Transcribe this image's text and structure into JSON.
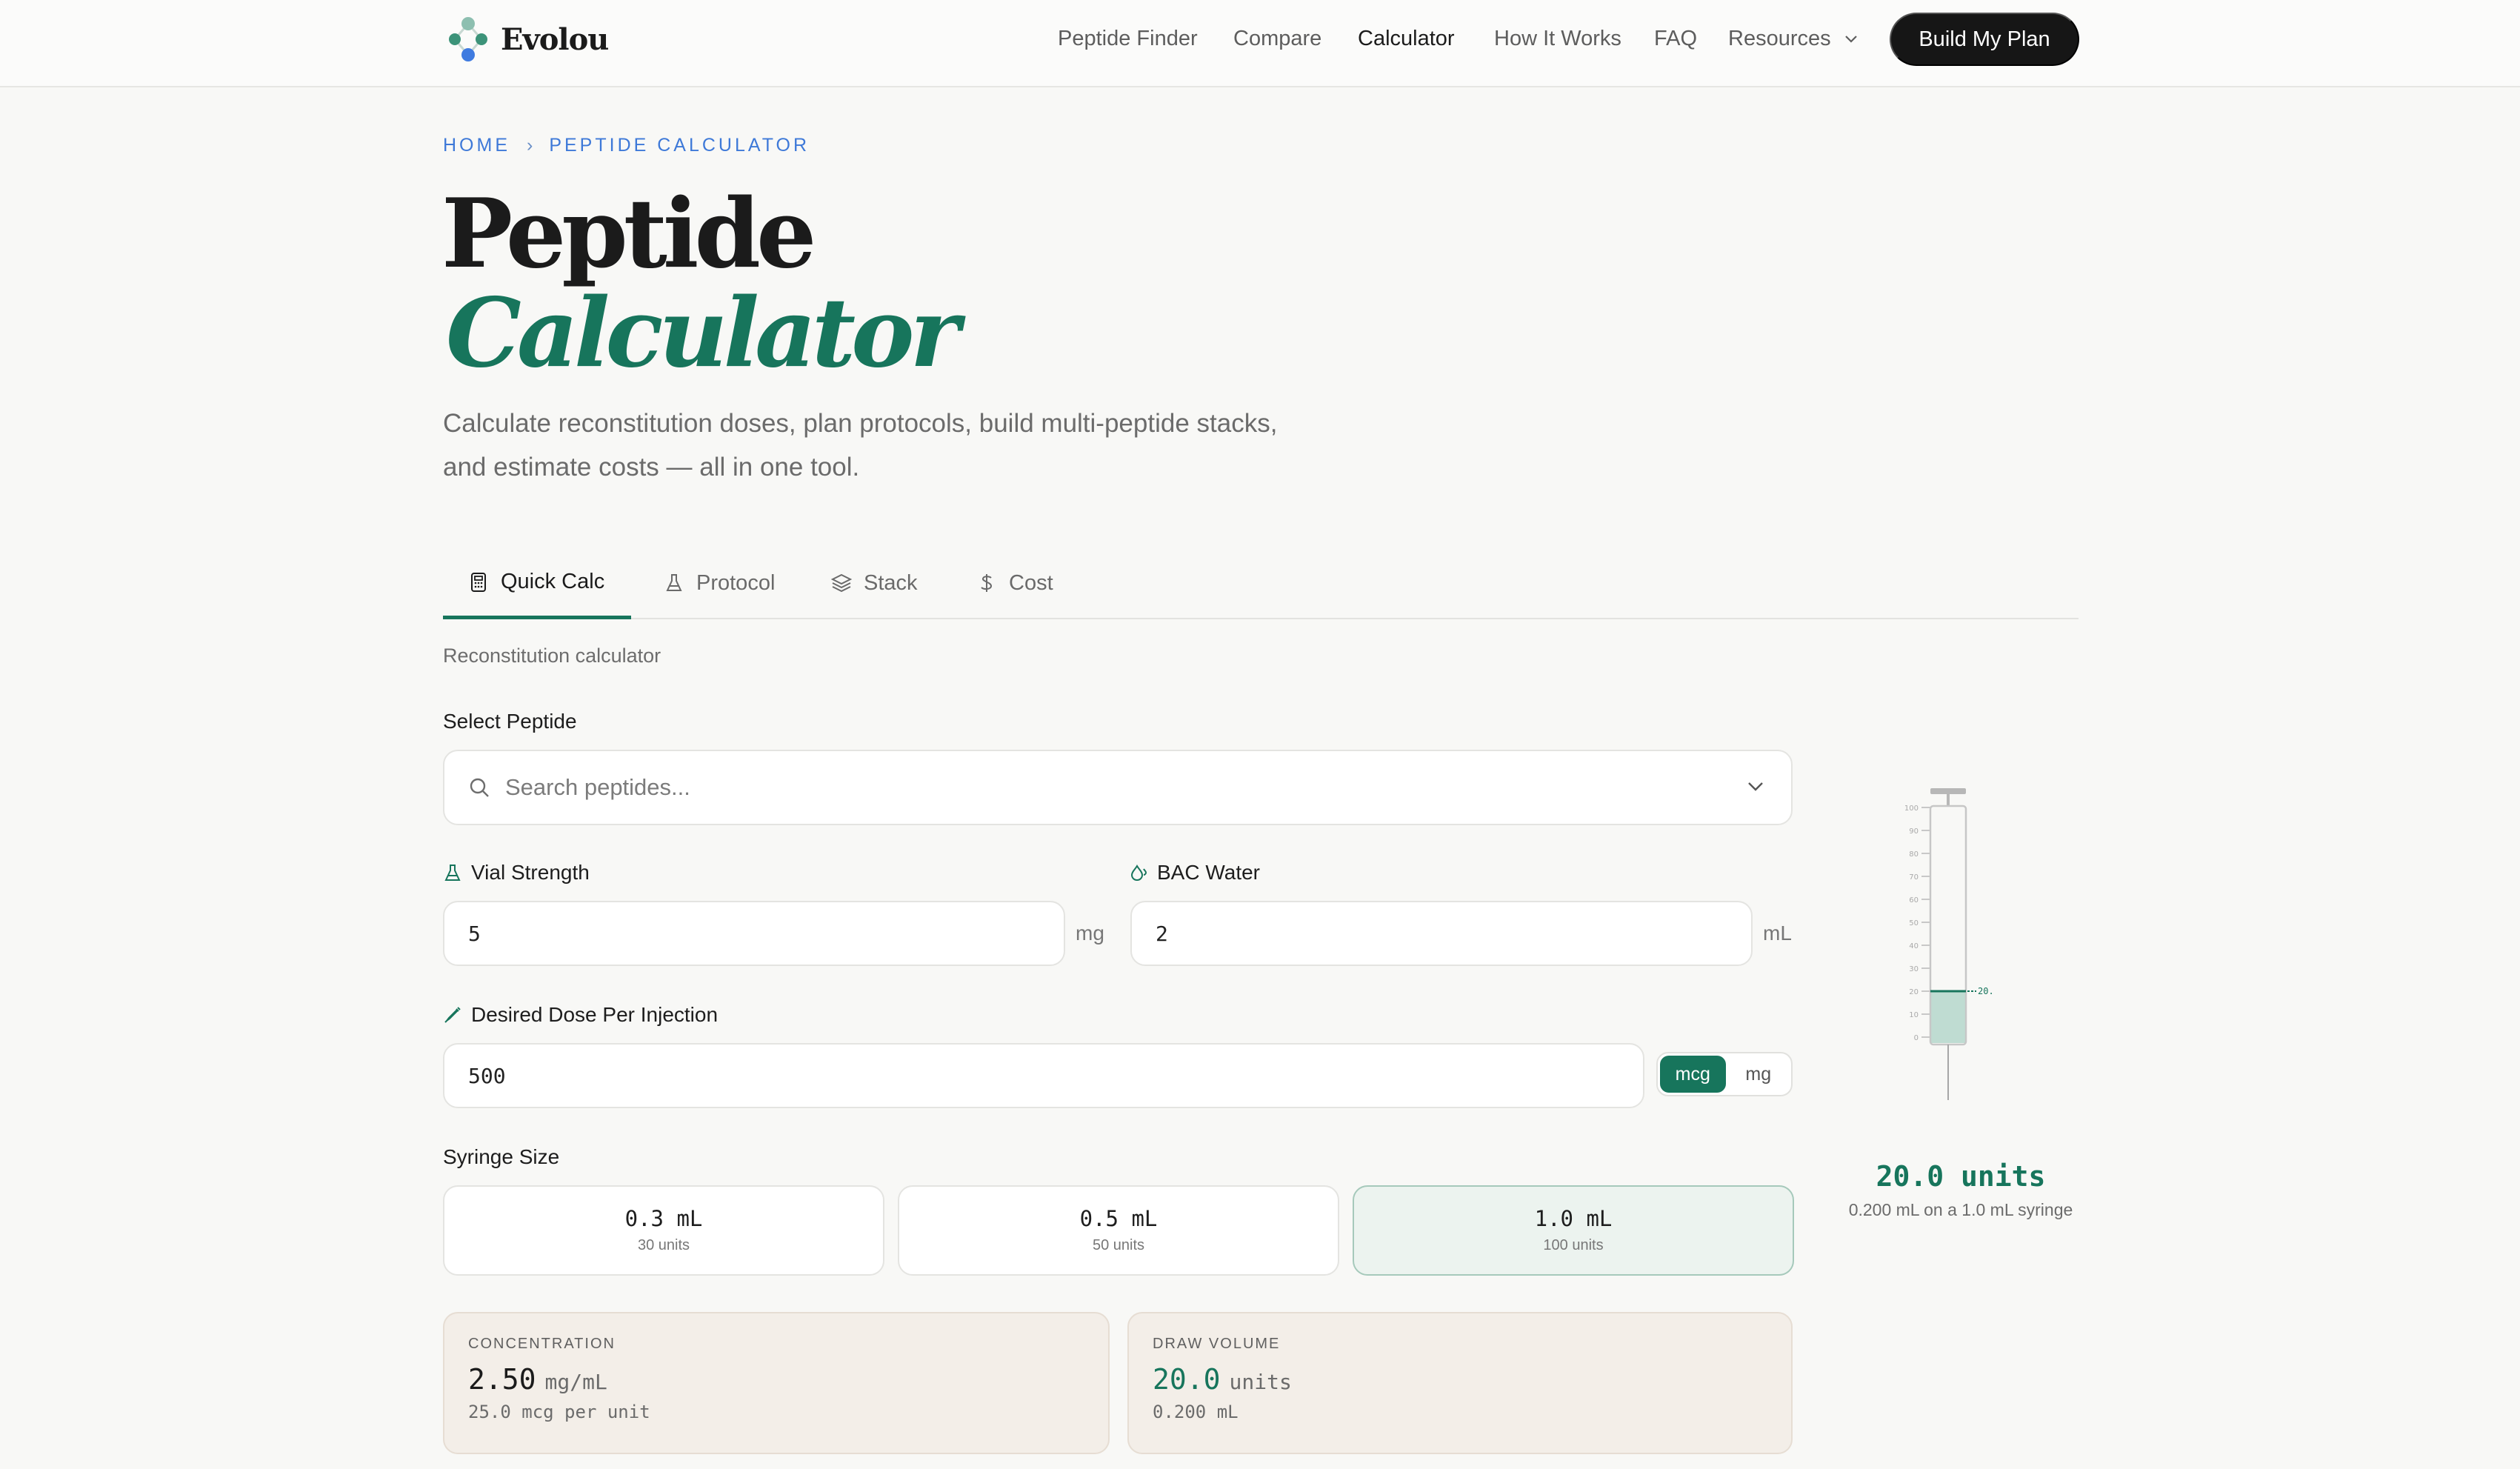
{
  "brand": {
    "name": "Evolou"
  },
  "nav": {
    "items": [
      "Peptide Finder",
      "Compare",
      "Calculator",
      "How It Works",
      "FAQ",
      "Resources"
    ],
    "active": "Calculator",
    "cta": "Build My Plan"
  },
  "breadcrumb": {
    "home": "HOME",
    "current": "PEPTIDE CALCULATOR"
  },
  "hero": {
    "title_line1": "Peptide",
    "title_line2": "Calculator",
    "description": "Calculate reconstitution doses, plan protocols, build multi-peptide stacks, and estimate costs — all in one tool."
  },
  "tabs": [
    "Quick Calc",
    "Protocol",
    "Stack",
    "Cost"
  ],
  "section_label": "Reconstitution calculator",
  "form": {
    "peptide_label": "Select Peptide",
    "peptide_placeholder": "Search peptides...",
    "vial_label": "Vial Strength",
    "vial_value": "5",
    "vial_unit": "mg",
    "water_label": "BAC Water",
    "water_value": "2",
    "water_unit": "mL",
    "dose_label": "Desired Dose Per Injection",
    "dose_value": "500",
    "dose_units": [
      "mcg",
      "mg"
    ],
    "dose_unit_selected": "mcg",
    "syringe_label": "Syringe Size",
    "syringe_options": [
      {
        "size": "0.3 mL",
        "units": "30 units"
      },
      {
        "size": "0.5 mL",
        "units": "50 units"
      },
      {
        "size": "1.0 mL",
        "units": "100 units"
      }
    ],
    "syringe_selected": "1.0 mL"
  },
  "results": {
    "concentration": {
      "caption": "CONCENTRATION",
      "value": "2.50",
      "unit": "mg/mL",
      "sub": "25.0 mcg per unit"
    },
    "draw": {
      "caption": "DRAW VOLUME",
      "value": "20.0",
      "unit": "units",
      "sub": "0.200 mL"
    }
  },
  "syringe_visual": {
    "readout": "20.0 units",
    "caption": "0.200 mL on a 1.0 mL syringe",
    "marker_label": "20.",
    "fill_units": 20,
    "max_units": 100,
    "scale_labels": [
      "100",
      "90",
      "80",
      "70",
      "60",
      "50",
      "40",
      "30",
      "20",
      "10",
      "0"
    ]
  },
  "colors": {
    "accent": "#17755c",
    "link": "#3e79d8",
    "dark": "#161616"
  },
  "icons": {
    "search": "search-icon",
    "chevron": "chevron-down-icon",
    "flask": "flask-icon",
    "drop": "water-drop-icon",
    "syringe": "syringe-icon",
    "calculator": "calculator-icon",
    "layers": "layers-icon",
    "dollar": "dollar-icon"
  }
}
